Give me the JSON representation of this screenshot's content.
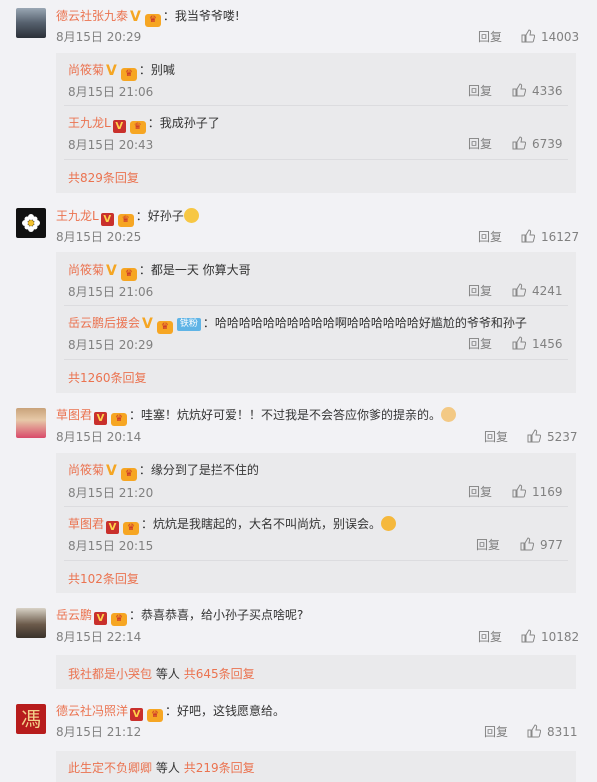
{
  "labels": {
    "reply": "回复",
    "total": "共",
    "replies": "条回复",
    "others": "等人"
  },
  "comments": [
    {
      "user": "德云社张九泰",
      "text": "：我当爷爷喽!",
      "time": "8月15日 20:29",
      "likes": "14003",
      "replies": [
        {
          "user": "尚筱菊",
          "text": "：别喊",
          "time": "8月15日 21:06",
          "likes": "4336"
        },
        {
          "user": "王九龙L",
          "text": "：我成孙子了",
          "time": "8月15日 20:43",
          "likes": "6739"
        }
      ],
      "more": "共829条回复"
    },
    {
      "user": "王九龙L",
      "text": "：好孙子",
      "time": "8月15日 20:25",
      "likes": "16127",
      "replies": [
        {
          "user": "尚筱菊",
          "text": "：都是一天 你算大哥",
          "time": "8月15日 21:06",
          "likes": "4241"
        },
        {
          "user": "岳云鹏后援会",
          "tag": "铁粉",
          "text": "：哈哈哈哈哈哈哈哈哈哈啊哈哈哈哈哈哈好尴尬的爷爷和孙子",
          "time": "8月15日 20:29",
          "likes": "1456"
        }
      ],
      "more": "共1260条回复"
    },
    {
      "user": "草图君",
      "text": "：哇塞！炕炕好可爱！！不过我是不会答应你爹的提亲的。",
      "time": "8月15日 20:14",
      "likes": "5237",
      "replies": [
        {
          "user": "尚筱菊",
          "text": "：缘分到了是拦不住的",
          "time": "8月15日 21:20",
          "likes": "1169"
        },
        {
          "user": "草图君",
          "text": "：炕炕是我瞎起的，大名不叫尚炕，别误会。",
          "time": "8月15日 20:15",
          "likes": "977"
        }
      ],
      "more": "共102条回复"
    },
    {
      "user": "岳云鹏",
      "text": "：恭喜恭喜，给小孙子买点啥呢?",
      "time": "8月15日 22:14",
      "likes": "10182",
      "moreUser": "我社都是小哭包",
      "moreCount": "共645条回复"
    },
    {
      "user": "德云社冯照洋",
      "text": "：好吧，这钱愿意给。",
      "time": "8月15日 21:12",
      "likes": "8311",
      "moreUser": "此生定不负卿卿",
      "moreCount": "共219条回复"
    }
  ],
  "colors": {
    "username": "#eb7350",
    "meta": "#808080",
    "background": "#f2f2f5",
    "subBackground": "#eaeaec"
  }
}
